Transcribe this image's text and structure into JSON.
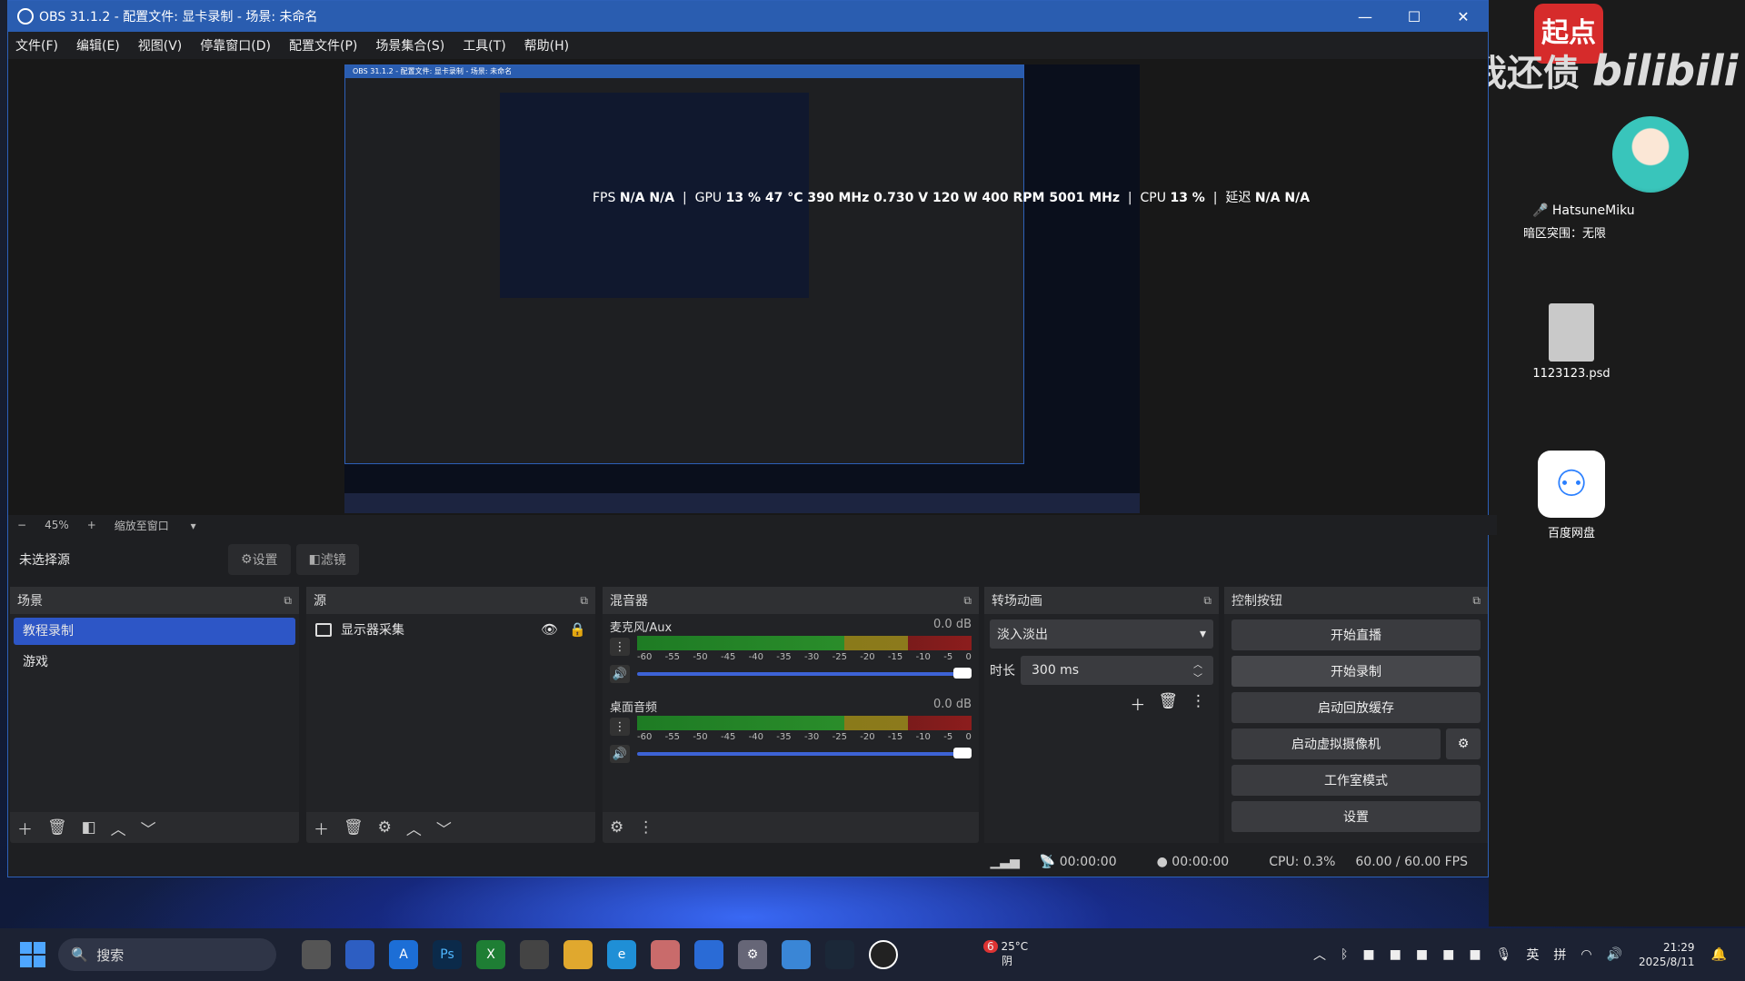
{
  "window": {
    "title": "OBS 31.1.2 - 配置文件: 显卡录制 - 场景: 未命名",
    "menu": [
      "文件(F)",
      "编辑(E)",
      "视图(V)",
      "停靠窗口(D)",
      "配置文件(P)",
      "场景集合(S)",
      "工具(T)",
      "帮助(H)"
    ]
  },
  "overlay": {
    "fps_label": "FPS",
    "fps_value": "N/A N/A",
    "gpu_label": "GPU",
    "gpu_value": "13 % 47 °C 390 MHz 0.730 V 120 W 400 RPM 5001 MHz",
    "cpu_label": "CPU",
    "cpu_value": "13 %",
    "latency_label": "延迟",
    "latency_value": "N/A N/A"
  },
  "zoom": {
    "level": "45%",
    "fit_label": "缩放至窗口"
  },
  "source_bar": {
    "label": "未选择源",
    "settings": "设置",
    "filters": "滤镜"
  },
  "scenes": {
    "title": "场景",
    "items": [
      "教程录制",
      "游戏"
    ]
  },
  "sources": {
    "title": "源",
    "items": [
      "显示器采集"
    ]
  },
  "mixer": {
    "title": "混音器",
    "tracks": [
      {
        "name": "麦克风/Aux",
        "db": "0.0 dB",
        "level": 0
      },
      {
        "name": "桌面音频",
        "db": "0.0 dB",
        "level": 0
      }
    ],
    "ticks": [
      "-60",
      "-55",
      "-50",
      "-45",
      "-40",
      "-35",
      "-30",
      "-25",
      "-20",
      "-15",
      "-10",
      "-5",
      "0"
    ]
  },
  "transitions": {
    "title": "转场动画",
    "selected": "淡入淡出",
    "duration_label": "时长",
    "duration": "300 ms"
  },
  "controls": {
    "title": "控制按钮",
    "start_stream": "开始直播",
    "start_record": "开始录制",
    "start_replay": "启动回放缓存",
    "start_vcam": "启动虚拟摄像机",
    "studio_mode": "工作室模式",
    "settings": "设置"
  },
  "status": {
    "stream_time": "00:00:00",
    "record_time": "00:00:00",
    "cpu": "CPU: 0.3%",
    "fps": "60.00 / 60.00 FPS"
  },
  "desktop": {
    "bili_text": "催我还债",
    "bili_brand": "bilibili",
    "qidian": "起点",
    "user": "HatsuneMiku",
    "user_sub": "暗区突围：无限",
    "psd_file": "1123123.psd",
    "baidu": "百度网盘"
  },
  "taskbar": {
    "search": "搜索",
    "weather_temp": "25°C",
    "weather_desc": "阴",
    "weather_badge": "6",
    "ime1": "英",
    "ime2": "拼",
    "time": "21:29",
    "date": "2025/8/11"
  }
}
